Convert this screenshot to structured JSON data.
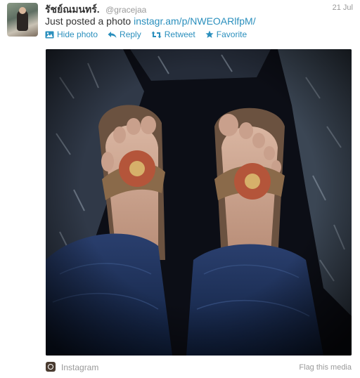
{
  "tweet": {
    "display_name": "รัชย์ณมนทร์.",
    "handle": "@gracejaa",
    "date": "21 Jul",
    "text_prefix": "Just posted a photo ",
    "link_text": "instagr.am/p/NWEOARlfpM/"
  },
  "actions": [
    {
      "label": "Hide photo",
      "icon": "photo-icon"
    },
    {
      "label": "Reply",
      "icon": "reply-icon"
    },
    {
      "label": "Retweet",
      "icon": "retweet-icon"
    },
    {
      "label": "Favorite",
      "icon": "star-icon"
    }
  ],
  "footer": {
    "source_label": "Instagram",
    "flag_label": "Flag this media"
  },
  "colors": {
    "link": "#2a8fbd",
    "name": "#333333",
    "muted": "#999999"
  }
}
